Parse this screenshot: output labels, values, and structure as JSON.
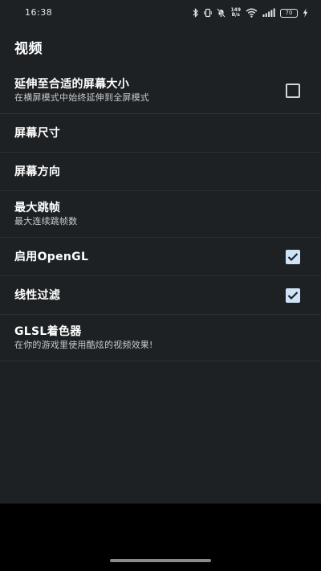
{
  "status_bar": {
    "time": "16:38",
    "network_speed_value": "149",
    "network_speed_unit": "B/s",
    "battery_level": "70"
  },
  "page": {
    "title": "视频"
  },
  "settings": [
    {
      "title": "延伸至合适的屏幕大小",
      "summary": "在横屏模式中始终延伸到全屏模式",
      "checked": false
    },
    {
      "title": "屏幕尺寸"
    },
    {
      "title": "屏幕方向"
    },
    {
      "title": "最大跳帧",
      "summary": "最大连续跳帧数"
    },
    {
      "title": "启用OpenGL",
      "checked": true
    },
    {
      "title": "线性过滤",
      "checked": true
    },
    {
      "title": "GLSL着色器",
      "summary": "在你的游戏里使用酷炫的视频效果!"
    }
  ],
  "colors": {
    "background": "#1e2124",
    "checkbox_checked": "#cfe3f7",
    "divider": "#2c3034"
  }
}
